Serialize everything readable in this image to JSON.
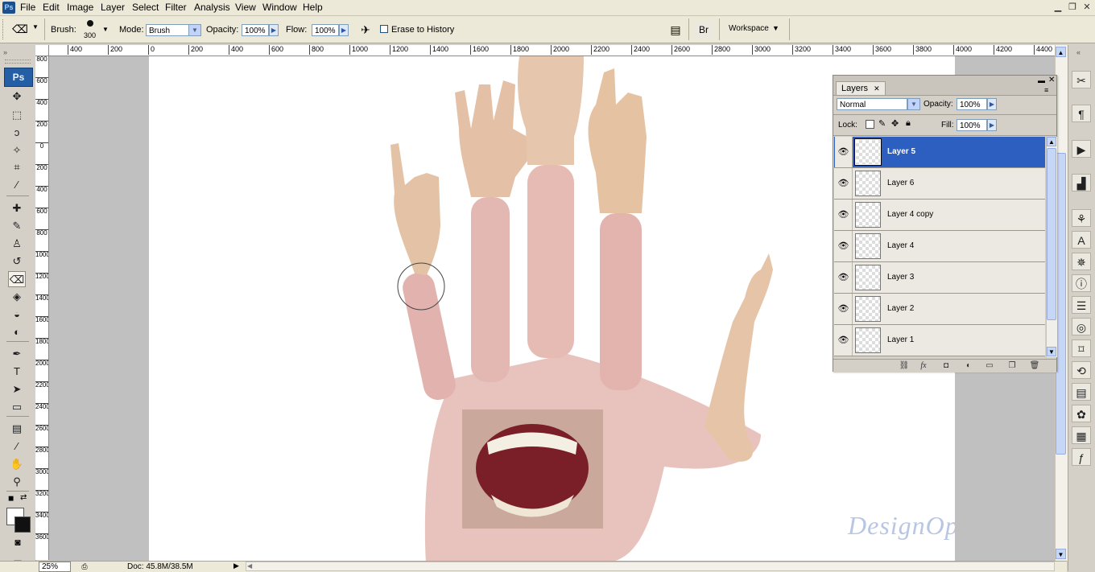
{
  "menubar": {
    "app_icon": "Ps",
    "items": [
      "File",
      "Edit",
      "Image",
      "Layer",
      "Select",
      "Filter",
      "Analysis",
      "View",
      "Window",
      "Help"
    ],
    "window_controls": [
      "minimize-icon",
      "restore-icon",
      "close-icon"
    ]
  },
  "options": {
    "tool_icon": "eraser-icon",
    "brush_label": "Brush:",
    "brush_size": "300",
    "mode_label": "Mode:",
    "mode_value": "Brush",
    "opacity_label": "Opacity:",
    "opacity_value": "100%",
    "flow_label": "Flow:",
    "flow_value": "100%",
    "airbrush_icon": "airbrush-icon",
    "erase_history_label": "Erase to History",
    "erase_history_checked": false,
    "workspace_label": "Workspace"
  },
  "toolbox": {
    "logo": "Ps",
    "tools": [
      {
        "name": "move-tool-icon",
        "glyph": "✥"
      },
      {
        "name": "marquee-tool-icon",
        "glyph": "⬚"
      },
      {
        "name": "lasso-tool-icon",
        "glyph": "ↄ"
      },
      {
        "name": "magic-wand-tool-icon",
        "glyph": "✧"
      },
      {
        "name": "crop-tool-icon",
        "glyph": "⌗"
      },
      {
        "name": "eyedropper-tool-icon",
        "glyph": "⁄"
      },
      {
        "name": "healing-brush-tool-icon",
        "glyph": "✚"
      },
      {
        "name": "brush-tool-icon",
        "glyph": "✎"
      },
      {
        "name": "clone-stamp-tool-icon",
        "glyph": "♙"
      },
      {
        "name": "history-brush-tool-icon",
        "glyph": "↺"
      },
      {
        "name": "eraser-tool-icon",
        "glyph": "⌫"
      },
      {
        "name": "paint-bucket-tool-icon",
        "glyph": "◈"
      },
      {
        "name": "blur-tool-icon",
        "glyph": "◒"
      },
      {
        "name": "dodge-tool-icon",
        "glyph": "◐"
      },
      {
        "name": "pen-tool-icon",
        "glyph": "✒"
      },
      {
        "name": "type-tool-icon",
        "glyph": "T"
      },
      {
        "name": "path-selection-tool-icon",
        "glyph": "➤"
      },
      {
        "name": "rectangle-tool-icon",
        "glyph": "▭"
      },
      {
        "name": "notes-tool-icon",
        "glyph": "▤"
      },
      {
        "name": "eyedropper-sample-tool-icon",
        "glyph": "⁄"
      },
      {
        "name": "hand-tool-icon",
        "glyph": "✋"
      },
      {
        "name": "zoom-tool-icon",
        "glyph": "⚲"
      }
    ],
    "active_tool": "eraser-tool-icon"
  },
  "rulers": {
    "horizontal": [
      "400",
      "200",
      "0",
      "200",
      "400",
      "600",
      "800",
      "1000",
      "1200",
      "1400",
      "1600",
      "1800",
      "2000",
      "2200",
      "2400",
      "2600",
      "2800",
      "3000",
      "3200",
      "3400",
      "3600",
      "3800",
      "4000",
      "4200",
      "4400"
    ],
    "vertical": [
      "800",
      "600",
      "400",
      "200",
      "0",
      "200",
      "400",
      "600",
      "800",
      "1000",
      "1200",
      "1400",
      "1600",
      "1800",
      "2000",
      "2200",
      "2400",
      "2600",
      "2800",
      "3000",
      "3200",
      "3400",
      "3600"
    ]
  },
  "canvas": {
    "watermark": "DesignOptimal.com"
  },
  "layers_panel": {
    "tab_label": "Layers",
    "blend_mode": "Normal",
    "opacity_label": "Opacity:",
    "opacity_value": "100%",
    "lock_label": "Lock:",
    "fill_label": "Fill:",
    "fill_value": "100%",
    "layers": [
      {
        "name": "Layer 5",
        "visible": true,
        "selected": true
      },
      {
        "name": "Layer 6",
        "visible": true,
        "selected": false
      },
      {
        "name": "Layer 4 copy",
        "visible": true,
        "selected": false
      },
      {
        "name": "Layer 4",
        "visible": true,
        "selected": false
      },
      {
        "name": "Layer 3",
        "visible": true,
        "selected": false
      },
      {
        "name": "Layer 2",
        "visible": true,
        "selected": false
      },
      {
        "name": "Layer 1",
        "visible": true,
        "selected": false
      }
    ],
    "bottom_icons": [
      "link-layers-icon",
      "fx-icon",
      "mask-icon",
      "adjustment-icon",
      "group-icon",
      "new-layer-icon",
      "trash-icon"
    ]
  },
  "status": {
    "zoom": "25%",
    "doc_info": "Doc: 45.8M/38.5M"
  },
  "right_dock_icons": [
    "tools-preset-icon",
    "paragraph-icon",
    "actions-icon",
    "histogram-icon",
    "clone-source-icon",
    "character-icon",
    "navigator-icon",
    "info-icon",
    "layer-comps-icon",
    "channels-icon",
    "paths-icon",
    "history-icon",
    "notes-icon",
    "styles-icon",
    "swatches-icon",
    "fx-panel-icon"
  ],
  "colors": {
    "selected_layer": "#2c5fbf",
    "workspace_gray": "#c0c0c0",
    "chrome": "#d4d0c8",
    "accent": "#245ea4"
  }
}
